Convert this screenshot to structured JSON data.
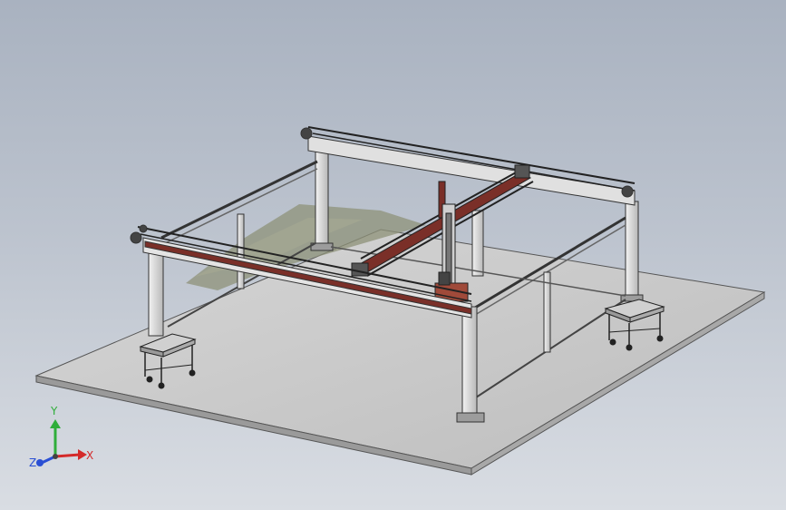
{
  "viewport": {
    "background_top": "#a9b2c0",
    "background_bottom": "#d9dde3"
  },
  "axis_triad": {
    "x_label": "X",
    "y_label": "Y",
    "z_label": "Z",
    "x_color": "#d42a2a",
    "y_color": "#2fae3a",
    "z_color": "#2a4fd4"
  },
  "model": {
    "base_plate_color": "#c9c9c9",
    "frame_color": "#d8d8d8",
    "beam_accent_color": "#7a2f28",
    "ground_texture_color": "#8e9178"
  }
}
